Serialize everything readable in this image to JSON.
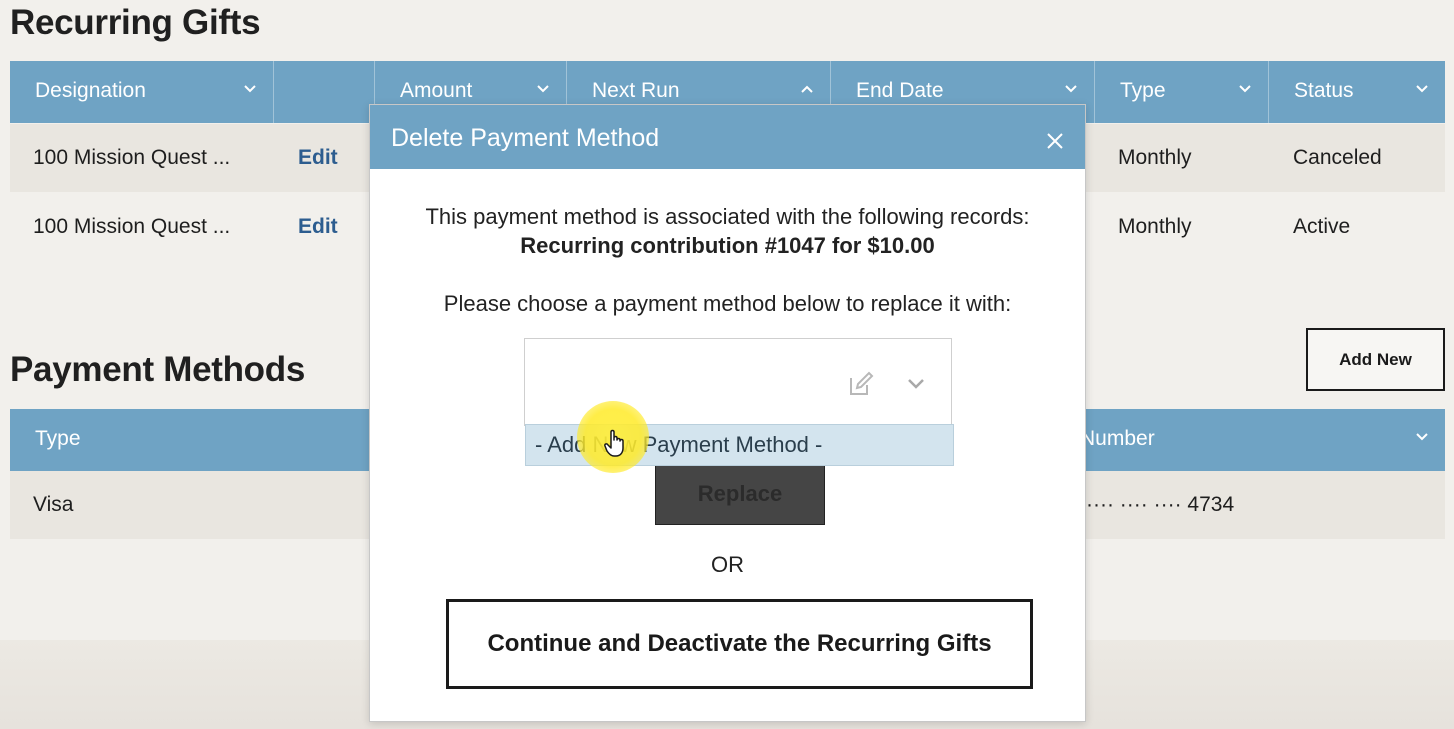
{
  "recurring_gifts": {
    "title": "Recurring Gifts",
    "columns": [
      {
        "label": "Designation",
        "sort": "chevron-down-icon"
      },
      {
        "label": "",
        "sort": ""
      },
      {
        "label": "Amount",
        "sort": "chevron-down-icon"
      },
      {
        "label": "Next Run",
        "sort": "chevron-up-icon"
      },
      {
        "label": "End Date",
        "sort": "chevron-down-icon"
      },
      {
        "label": "Type",
        "sort": "chevron-down-icon"
      },
      {
        "label": "Status",
        "sort": "chevron-down-icon"
      }
    ],
    "rows": [
      {
        "designation": "100 Mission Quest ...",
        "action": "Edit",
        "type": "Monthly",
        "status": "Canceled"
      },
      {
        "designation": "100 Mission Quest ...",
        "action": "Edit",
        "type": "Monthly",
        "status": "Active"
      }
    ]
  },
  "payment_methods": {
    "title": "Payment Methods",
    "add_new_label": "Add New",
    "columns": [
      {
        "label": "Type"
      },
      {
        "label": "Number"
      }
    ],
    "rows": [
      {
        "type": "Visa",
        "number": "···· ···· ···· 4734"
      }
    ]
  },
  "modal": {
    "title": "Delete Payment Method",
    "associated_text": "This payment method is associated with the following records:",
    "record_text": "Recurring contribution #1047 for $10.00",
    "choose_text": "Please choose a payment method below to replace it with:",
    "select_value": "",
    "dropdown_options": [
      "- Add New Payment Method -"
    ],
    "replace_label": "Replace",
    "or_text": "OR",
    "deactivate_label": "Continue and Deactivate the Recurring Gifts"
  },
  "colors": {
    "header_blue": "#6fa3c4",
    "row_shade": "#e9e6e0",
    "link_blue": "#2d5d8f",
    "cursor_highlight": "#ffe93c"
  }
}
